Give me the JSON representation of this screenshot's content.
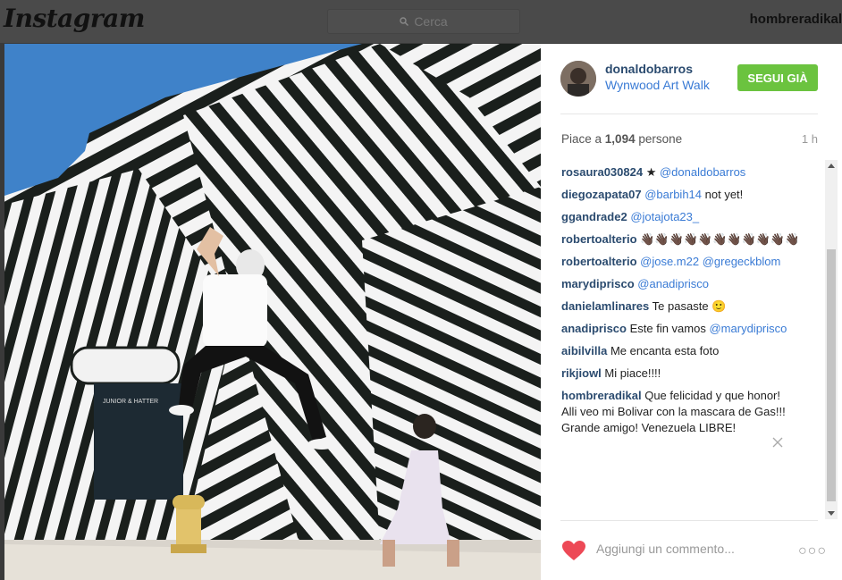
{
  "header": {
    "logo": "Instagram",
    "search_placeholder": "Cerca",
    "username": "hombreradikal"
  },
  "post": {
    "owner": "donaldobarros",
    "location": "Wynwood Art Walk",
    "follow_label": "SEGUI GIÀ",
    "likes_prefix": "Piace a",
    "likes_count": "1,094",
    "likes_suffix": "persone",
    "time": "1 h",
    "photo_sign": "JUNIOR & HATTER",
    "comments": [
      {
        "user": "rosaura030824",
        "text": "★",
        "mention": "@donaldobarros"
      },
      {
        "user": "diegozapata07",
        "mention": "@barbih14",
        "text": "not yet!"
      },
      {
        "user": "ggandrade2",
        "mention": "@jotajota23_"
      },
      {
        "user": "robertoalterio",
        "text": "👋🏿👋🏿👋🏿👋🏿👋🏿👋🏿👋🏿👋🏿👋🏿👋🏿👋🏿"
      },
      {
        "user": "robertoalterio",
        "mention": "@jose.m22",
        "mention2": "@gregeckblom"
      },
      {
        "user": "marydiprisco",
        "mention": "@anadiprisco"
      },
      {
        "user": "danielamlinares",
        "text": "Te pasaste 🙂"
      },
      {
        "user": "anadiprisco",
        "text": "Este fin vamos",
        "mention": "@marydiprisco"
      },
      {
        "user": "aibilvilla",
        "text": "Me encanta esta foto"
      },
      {
        "user": "rikjiowl",
        "text": "Mi piace!!!!"
      },
      {
        "user": "hombreradikal",
        "text": "Que felicidad y que honor! Alli veo mi Bolivar con la mascara de Gas!!! Grande amigo! Venezuela LIBRE!"
      }
    ],
    "add_comment_placeholder": "Aggiungi un commento...",
    "more_label": "○○○"
  },
  "colors": {
    "follow_green": "#6bc33f",
    "link_blue": "#3a7bd5",
    "username_dark": "#2b4b6f",
    "heart_red": "#ed4956"
  }
}
